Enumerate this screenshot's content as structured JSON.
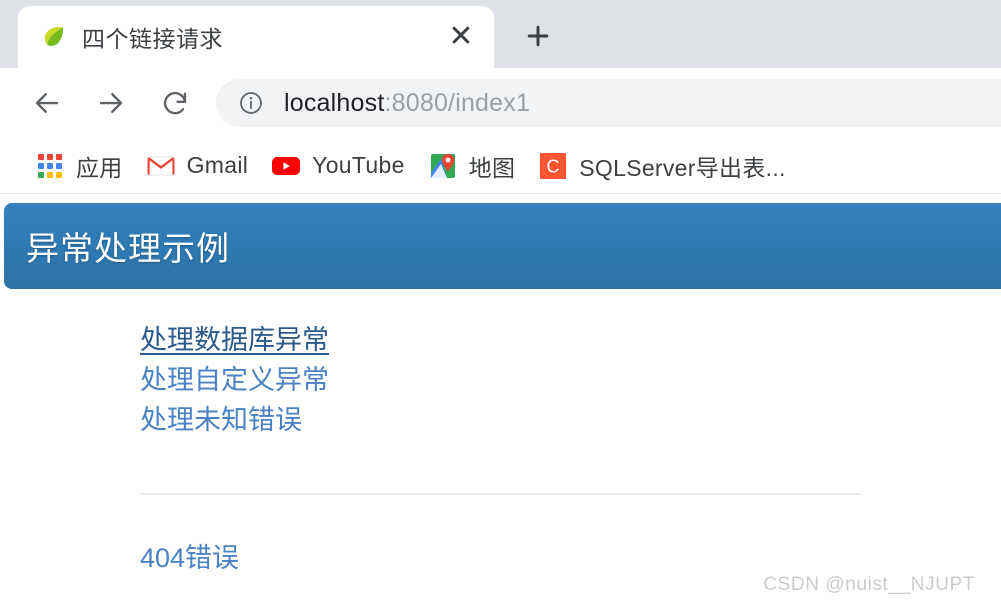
{
  "browser": {
    "tab": {
      "title": "四个链接请求",
      "favicon_name": "spring-boot-leaf-icon",
      "close_label": "✕"
    },
    "new_tab_label": "+",
    "nav": {
      "back_label": "←",
      "forward_label": "→",
      "reload_label": "⟳"
    },
    "omnibox": {
      "info_icon": "site-info-icon",
      "host": "localhost",
      "path": ":8080/index1",
      "full_url": "localhost:8080/index1"
    },
    "bookmarks": [
      {
        "label": "应用",
        "icon": "apps-grid-icon"
      },
      {
        "label": "Gmail",
        "icon": "gmail-icon"
      },
      {
        "label": "YouTube",
        "icon": "youtube-icon"
      },
      {
        "label": "地图",
        "icon": "google-maps-icon"
      },
      {
        "label": "SQLServer导出表...",
        "icon": "csdn-icon"
      }
    ]
  },
  "page": {
    "banner": {
      "title": "异常处理示例",
      "background_color": "#2e79b2",
      "text_color": "#ffffff"
    },
    "links": [
      {
        "label": "处理数据库异常",
        "state": "hover"
      },
      {
        "label": "处理自定义异常",
        "state": "normal"
      },
      {
        "label": "处理未知错误",
        "state": "normal"
      }
    ],
    "bottom_link": {
      "label": "404错误",
      "state": "normal"
    },
    "link_color": "#4a82c3",
    "link_hover_color": "#2a5a8c"
  },
  "watermark": "CSDN @nuist__NJUPT"
}
